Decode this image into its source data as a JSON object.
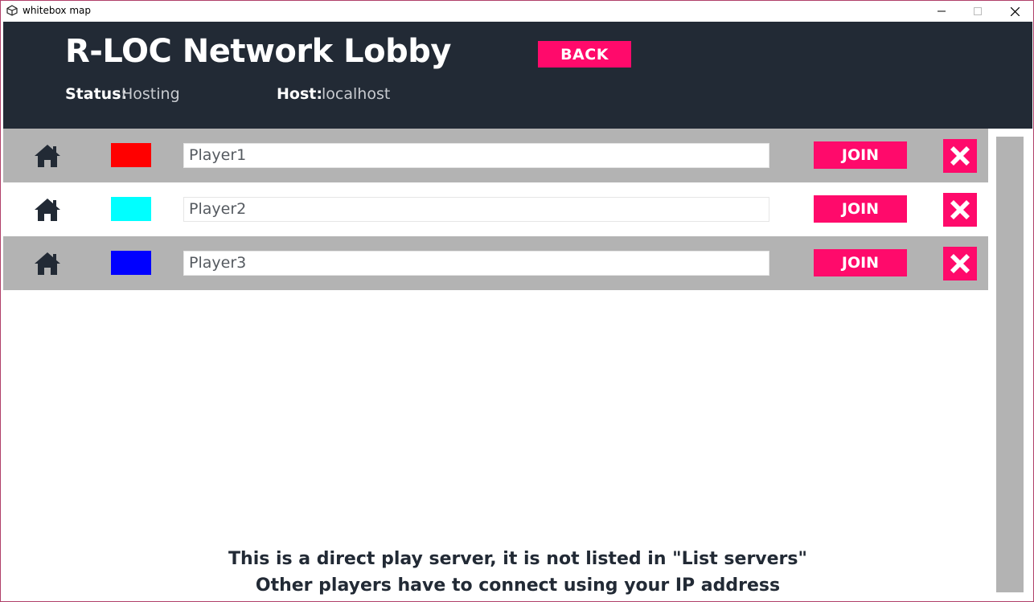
{
  "window": {
    "title": "whitebox map",
    "icon": "unity-logo-icon",
    "controls": [
      "minimize-icon",
      "maximize-icon",
      "close-icon"
    ]
  },
  "header": {
    "title": "R-LOC Network Lobby",
    "back_label": "BACK",
    "status_label": "Status:",
    "status_value": "Hosting",
    "host_label": "Host:",
    "host_value": "localhost",
    "bg_color": "#222a35",
    "accent_color": "#ff0a6b"
  },
  "players": [
    {
      "name": "Player1",
      "color": "#ff0000",
      "join_label": "JOIN",
      "row_style": "gray"
    },
    {
      "name": "Player2",
      "color": "#00ffff",
      "join_label": "JOIN",
      "row_style": "white"
    },
    {
      "name": "Player3",
      "color": "#0000ff",
      "join_label": "JOIN",
      "row_style": "gray"
    }
  ],
  "footer": {
    "line1": "This is a direct play server, it is not listed in \"List servers\"",
    "line2": "Other players have to connect using your IP address"
  }
}
